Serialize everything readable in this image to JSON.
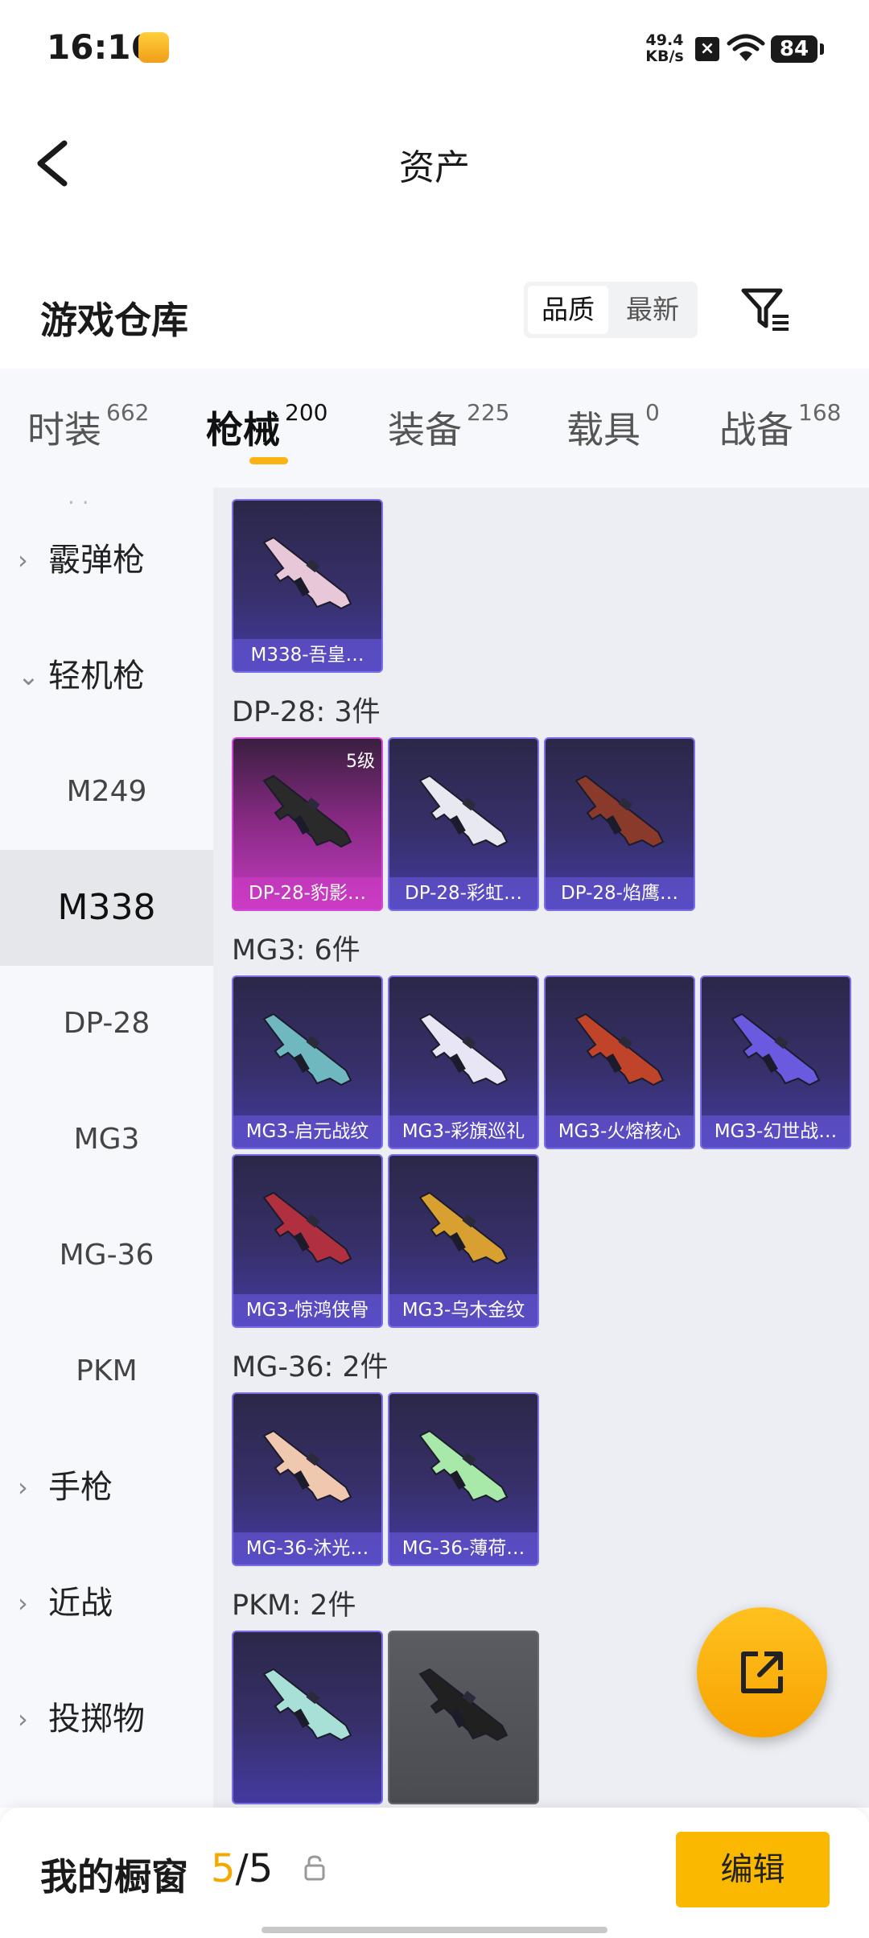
{
  "status_bar": {
    "time": "16:16",
    "net_speed_value": "49.4",
    "net_speed_unit": "KB/s",
    "battery": "84",
    "icons": [
      "app-icon",
      "x-icon",
      "wifi-icon",
      "battery-icon"
    ]
  },
  "header": {
    "title": "资产"
  },
  "warehouse": {
    "title": "游戏仓库",
    "sort_options": [
      "品质",
      "最新"
    ],
    "sort_selected": "品质"
  },
  "tabs": [
    {
      "label": "时装",
      "count": "662"
    },
    {
      "label": "枪械",
      "count": "200",
      "active": true
    },
    {
      "label": "装备",
      "count": "225"
    },
    {
      "label": "载具",
      "count": "0"
    },
    {
      "label": "战备",
      "count": "168"
    }
  ],
  "sidebar": {
    "items": [
      {
        "label": "霰弹枪",
        "type": "group",
        "expanded": false
      },
      {
        "label": "轻机枪",
        "type": "group",
        "expanded": true
      },
      {
        "label": "M249",
        "type": "sub"
      },
      {
        "label": "M338",
        "type": "sub",
        "active": true
      },
      {
        "label": "DP-28",
        "type": "sub"
      },
      {
        "label": "MG3",
        "type": "sub"
      },
      {
        "label": "MG-36",
        "type": "sub"
      },
      {
        "label": "PKM",
        "type": "sub"
      },
      {
        "label": "手枪",
        "type": "group",
        "expanded": false
      },
      {
        "label": "近战",
        "type": "group",
        "expanded": false
      },
      {
        "label": "投掷物",
        "type": "group",
        "expanded": false
      }
    ]
  },
  "main": {
    "sections": [
      {
        "title": "",
        "items": [
          {
            "name": "M338-吾皇…",
            "style": "purple",
            "color": "#e8c8d8"
          }
        ]
      },
      {
        "title": "DP-28: 3件",
        "items": [
          {
            "name": "DP-28-豹影…",
            "style": "pink",
            "level": "5级",
            "color": "#2a2a2a"
          },
          {
            "name": "DP-28-彩虹…",
            "style": "purple",
            "color": "#e8e8f0"
          },
          {
            "name": "DP-28-焰鹰…",
            "style": "purple",
            "color": "#8a3a2a"
          }
        ]
      },
      {
        "title": "MG3: 6件",
        "items": [
          {
            "name": "MG3-启元战纹",
            "style": "purple",
            "color": "#6fb8c0"
          },
          {
            "name": "MG3-彩旗巡礼",
            "style": "purple",
            "color": "#e8e6f4"
          },
          {
            "name": "MG3-火熔核心",
            "style": "purple",
            "color": "#c0442a"
          },
          {
            "name": "MG3-幻世战…",
            "style": "purple",
            "color": "#6a5ae0"
          },
          {
            "name": "MG3-惊鸿侠骨",
            "style": "purple",
            "color": "#b03040"
          },
          {
            "name": "MG3-乌木金纹",
            "style": "purple",
            "color": "#d8a030"
          }
        ]
      },
      {
        "title": "MG-36: 2件",
        "items": [
          {
            "name": "MG-36-沐光…",
            "style": "purple",
            "color": "#f0c8b0"
          },
          {
            "name": "MG-36-薄荷…",
            "style": "purple",
            "color": "#a8e8a8"
          }
        ]
      },
      {
        "title": "PKM: 2件",
        "items": [
          {
            "name": "",
            "style": "purple",
            "color": "#a8e0d8"
          },
          {
            "name": "",
            "style": "gray",
            "color": "#202020"
          }
        ]
      }
    ]
  },
  "bottom_bar": {
    "label": "我的橱窗",
    "current": "5",
    "separator": "/",
    "total": "5",
    "edit_label": "编辑"
  },
  "colors": {
    "accent": "#fbb800",
    "card_purple": "#433aa0",
    "card_pink": "#c23cc0",
    "card_gray": "#4a4c52"
  }
}
